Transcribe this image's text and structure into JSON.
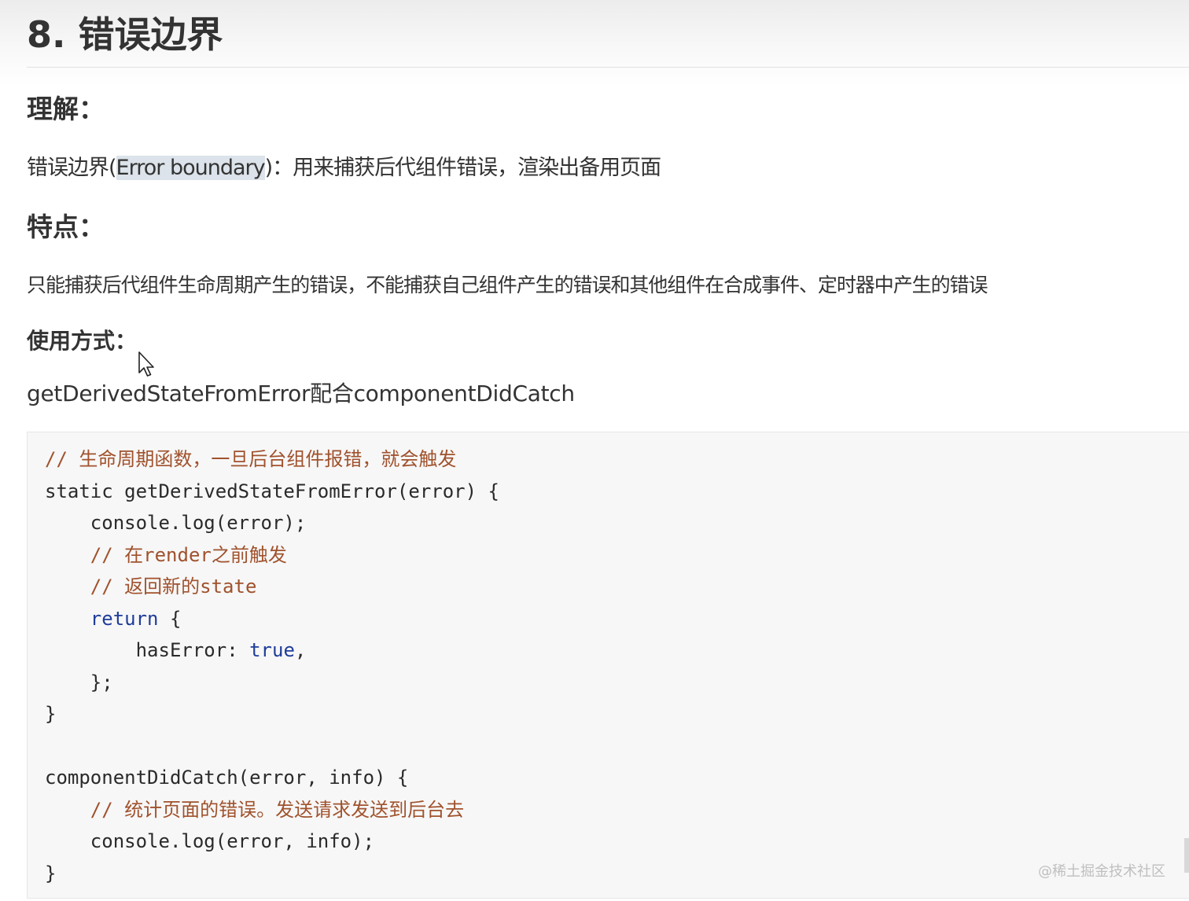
{
  "title": "8. 错误边界",
  "sections": {
    "understanding": {
      "heading": "理解：",
      "text_prefix": "错误边界(",
      "text_highlight": "Error boundary",
      "text_suffix": ")：用来捕获后代组件错误，渲染出备用页面"
    },
    "features": {
      "heading": "特点：",
      "text": "只能捕获后代组件生命周期产生的错误，不能捕获自己组件产生的错误和其他组件在合成事件、定时器中产生的错误"
    },
    "usage": {
      "heading": "使用方式：",
      "text": "getDerivedStateFromError配合componentDidCatch"
    }
  },
  "code": {
    "l1": "// 生命周期函数，一旦后台组件报错，就会触发",
    "l2": "static getDerivedStateFromError(error) {",
    "l3": "    console.log(error);",
    "l4": "    // 在render之前触发",
    "l5": "    // 返回新的state",
    "l6_kw": "return",
    "l6_rest": " {",
    "l7_prop": "hasError: ",
    "l7_val": "true",
    "l7_end": ",",
    "l8": "    };",
    "l9": "}",
    "l11": "componentDidCatch(error, info) {",
    "l12": "    // 统计页面的错误。发送请求发送到后台去",
    "l13": "    console.log(error, info);",
    "l14": "}"
  },
  "watermark": "@稀土掘金技术社区",
  "icons": {
    "cursor": "mouse-pointer-icon"
  }
}
